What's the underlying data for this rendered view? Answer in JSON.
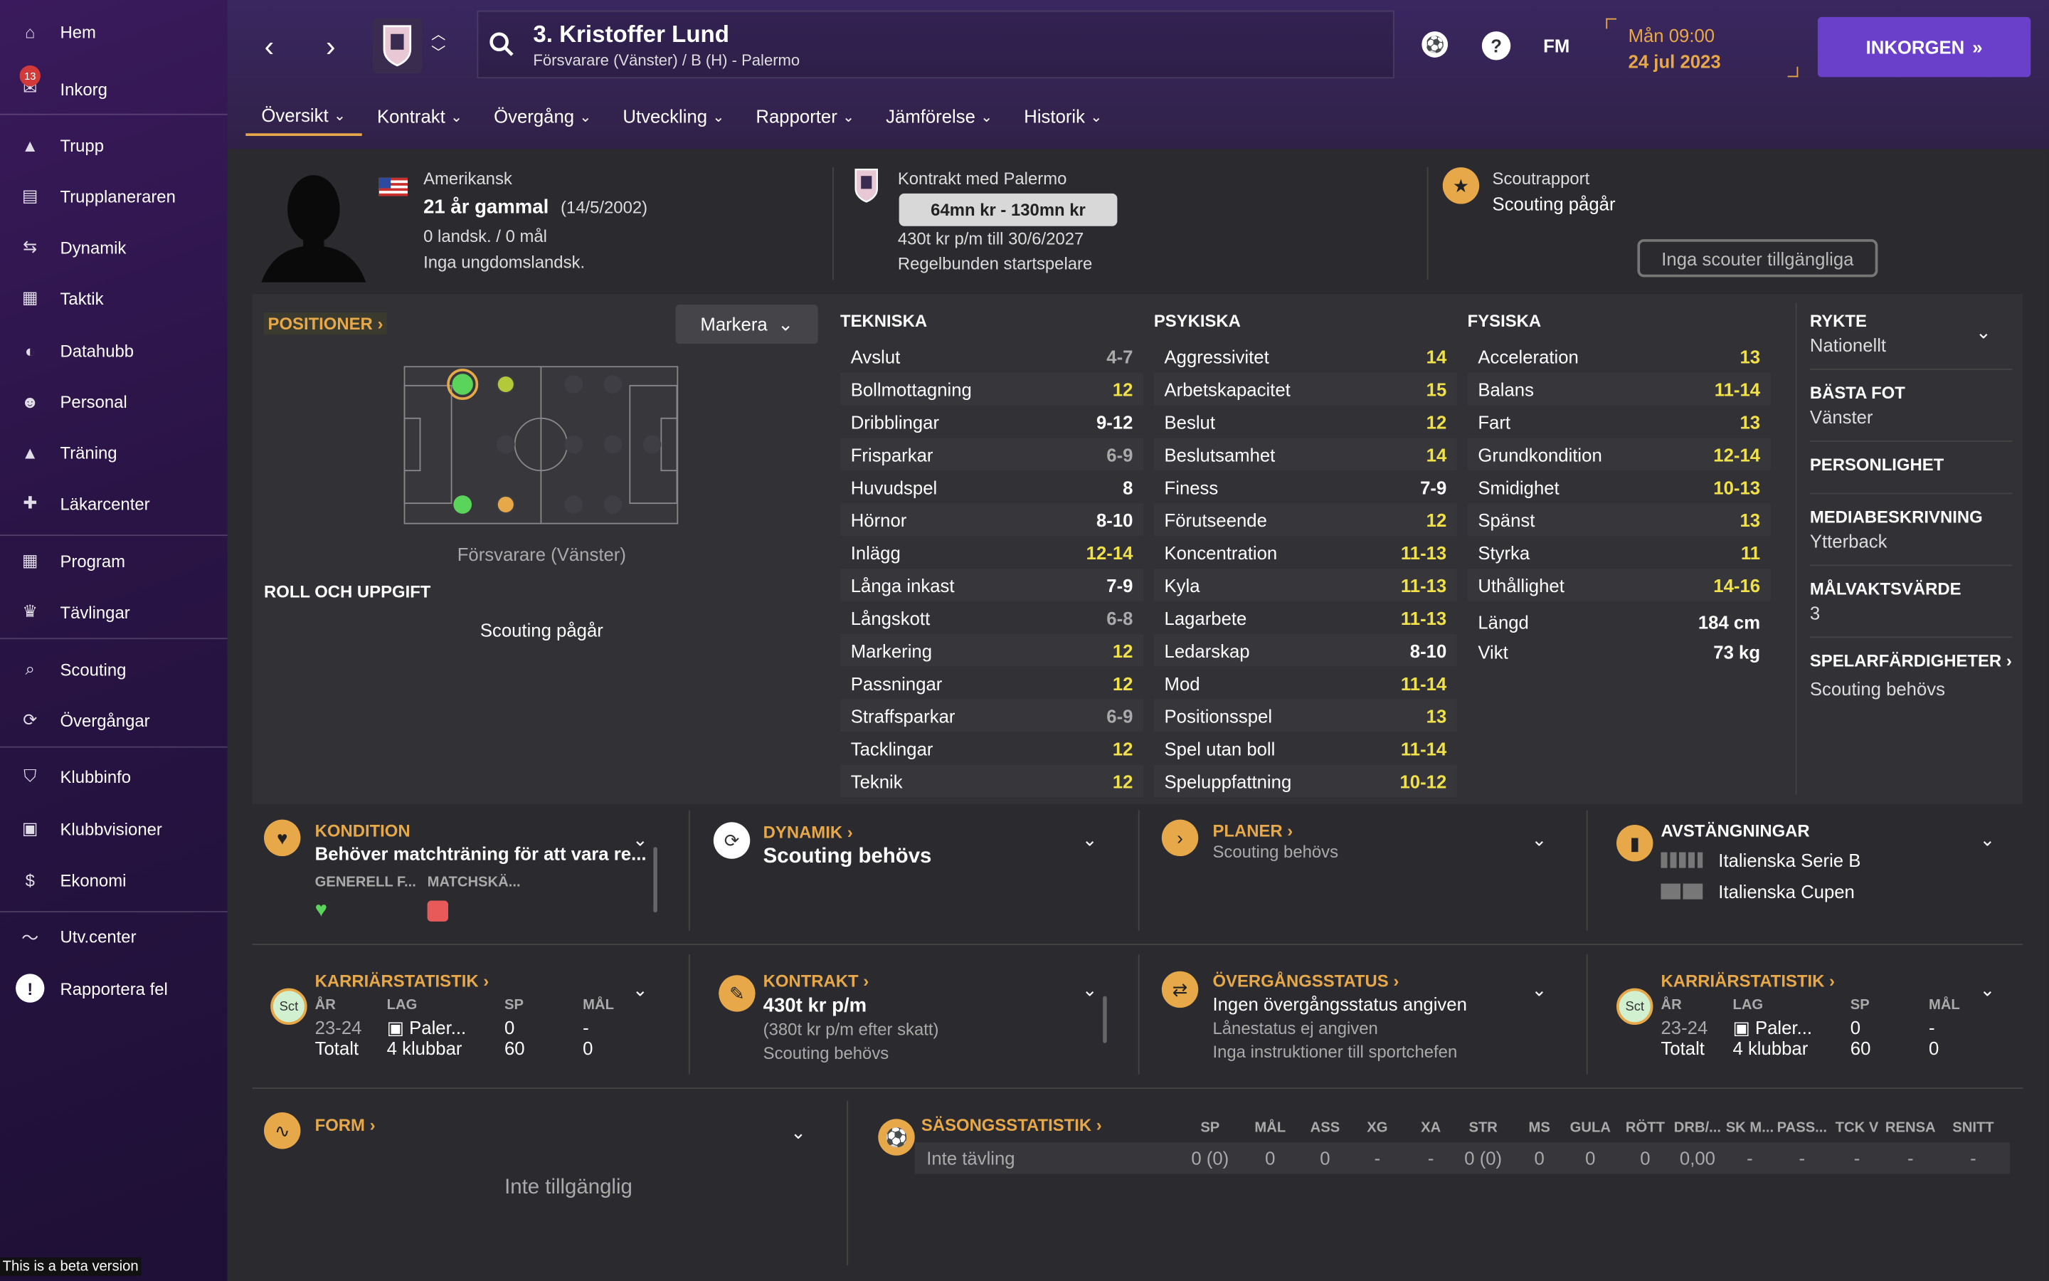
{
  "sidebar": {
    "items": [
      {
        "label": "Hem",
        "icon": "home-icon"
      },
      {
        "label": "Inkorg",
        "icon": "inbox-icon",
        "badge": "13"
      },
      {
        "label": "Trupp",
        "icon": "shirt-icon"
      },
      {
        "label": "Trupplaneraren",
        "icon": "clipboard-icon"
      },
      {
        "label": "Dynamik",
        "icon": "people-flow-icon"
      },
      {
        "label": "Taktik",
        "icon": "tactics-board-icon"
      },
      {
        "label": "Datahubb",
        "icon": "data-hub-icon"
      },
      {
        "label": "Personal",
        "icon": "staff-icon"
      },
      {
        "label": "Träning",
        "icon": "training-cone-icon"
      },
      {
        "label": "Läkarcenter",
        "icon": "medical-kit-icon"
      },
      {
        "label": "Program",
        "icon": "calendar-icon"
      },
      {
        "label": "Tävlingar",
        "icon": "trophy-icon"
      },
      {
        "label": "Scouting",
        "icon": "search-icon"
      },
      {
        "label": "Övergångar",
        "icon": "transfer-arrows-icon"
      },
      {
        "label": "Klubbinfo",
        "icon": "shield-icon"
      },
      {
        "label": "Klubbvisioner",
        "icon": "briefcase-icon"
      },
      {
        "label": "Ekonomi",
        "icon": "money-icon"
      },
      {
        "label": "Utv.center",
        "icon": "growth-chart-icon"
      },
      {
        "label": "Rapportera fel",
        "icon": "alert-icon"
      }
    ],
    "beta_text": "This is a beta version"
  },
  "header": {
    "title": "3. Kristoffer Lund",
    "subtitle": "Försvarare (Vänster) / B (H) - Palermo",
    "time": "Mån 09:00",
    "date": "24 jul 2023",
    "inbox_button": "INKORGEN",
    "fm_label": "FM",
    "tabs": [
      "Översikt",
      "Kontrakt",
      "Övergång",
      "Utveckling",
      "Rapporter",
      "Jämförelse",
      "Historik"
    ]
  },
  "profile": {
    "nationality": "Amerikansk",
    "age": "21 år gammal",
    "dob": "(14/5/2002)",
    "caps": "0 landsk. / 0 mål",
    "youth": "Inga ungdomslandsk.",
    "contract_title": "Kontrakt med Palermo",
    "value": "64mn kr - 130mn kr",
    "wage": "430t kr p/m till 30/6/2027",
    "role_status": "Regelbunden startspelare",
    "scout_title": "Scoutrapport",
    "scout_status": "Scouting pågår",
    "no_scouts": "Inga scouter tillgängliga"
  },
  "positions": {
    "header": "POSITIONER",
    "mark_button": "Markera",
    "position_label": "Försvarare (Vänster)",
    "role_header": "ROLL OCH UPPGIFT",
    "role_status": "Scouting pågår"
  },
  "attributes": {
    "technical": {
      "header": "TEKNISKA",
      "rows": [
        [
          "Avslut",
          "4-7"
        ],
        [
          "Bollmottagning",
          "12"
        ],
        [
          "Dribblingar",
          "9-12"
        ],
        [
          "Frisparkar",
          "6-9"
        ],
        [
          "Huvudspel",
          "8"
        ],
        [
          "Hörnor",
          "8-10"
        ],
        [
          "Inlägg",
          "12-14"
        ],
        [
          "Långa inkast",
          "7-9"
        ],
        [
          "Långskott",
          "6-8"
        ],
        [
          "Markering",
          "12"
        ],
        [
          "Passningar",
          "12"
        ],
        [
          "Straffsparkar",
          "6-9"
        ],
        [
          "Tacklingar",
          "12"
        ],
        [
          "Teknik",
          "12"
        ]
      ]
    },
    "mental": {
      "header": "PSYKISKA",
      "rows": [
        [
          "Aggressivitet",
          "14"
        ],
        [
          "Arbetskapacitet",
          "15"
        ],
        [
          "Beslut",
          "12"
        ],
        [
          "Beslutsamhet",
          "14"
        ],
        [
          "Finess",
          "7-9"
        ],
        [
          "Förutseende",
          "12"
        ],
        [
          "Koncentration",
          "11-13"
        ],
        [
          "Kyla",
          "11-13"
        ],
        [
          "Lagarbete",
          "11-13"
        ],
        [
          "Ledarskap",
          "8-10"
        ],
        [
          "Mod",
          "11-14"
        ],
        [
          "Positionsspel",
          "13"
        ],
        [
          "Spel utan boll",
          "11-14"
        ],
        [
          "Speluppfattning",
          "10-12"
        ]
      ]
    },
    "physical": {
      "header": "FYSISKA",
      "rows": [
        [
          "Acceleration",
          "13"
        ],
        [
          "Balans",
          "11-14"
        ],
        [
          "Fart",
          "13"
        ],
        [
          "Grundkondition",
          "12-14"
        ],
        [
          "Smidighet",
          "10-13"
        ],
        [
          "Spänst",
          "13"
        ],
        [
          "Styrka",
          "11"
        ],
        [
          "Uthållighet",
          "14-16"
        ]
      ],
      "height_label": "Längd",
      "height": "184 cm",
      "weight_label": "Vikt",
      "weight": "73 kg"
    }
  },
  "right_info": {
    "reputation_h": "RYKTE",
    "reputation": "Nationellt",
    "foot_h": "BÄSTA FOT",
    "foot": "Vänster",
    "personality_h": "PERSONLIGHET",
    "media_h": "MEDIABESKRIVNING",
    "media": "Ytterback",
    "gk_h": "MÅLVAKTSVÄRDE",
    "gk": "3",
    "traits_h": "SPELARFÄRDIGHETER",
    "traits": "Scouting behövs"
  },
  "cards": {
    "condition": {
      "title": "KONDITION",
      "text": "Behöver matchträning för att vara re...",
      "sub1": "GENERELL F...",
      "sub2": "MATCHSKÄ..."
    },
    "dynamics": {
      "title": "DYNAMIK",
      "text": "Scouting behövs"
    },
    "plans": {
      "title": "PLANER",
      "text": "Scouting behövs"
    },
    "bans": {
      "title": "AVSTÄNGNINGAR",
      "row1": "Italienska Serie B",
      "row2": "Italienska Cupen"
    },
    "career1": {
      "title": "KARRIÄRSTATISTIK",
      "badge": "Sct",
      "cols": [
        "ÅR",
        "LAG",
        "SP",
        "MÅL"
      ],
      "row1": [
        "23-24",
        "Paler...",
        "0",
        "-"
      ],
      "row2": [
        "Totalt",
        "4 klubbar",
        "60",
        "0"
      ]
    },
    "contract": {
      "title": "KONTRAKT",
      "text": "430t kr p/m",
      "sub1": "(380t kr p/m efter skatt)",
      "sub2": "Scouting behövs"
    },
    "transfer": {
      "title": "ÖVERGÅNGSSTATUS",
      "text": "Ingen övergångsstatus angiven",
      "sub1": "Lånestatus ej angiven",
      "sub2": "Inga instruktioner till sportchefen"
    },
    "career2": {
      "title": "KARRIÄRSTATISTIK",
      "badge": "Sct",
      "cols": [
        "ÅR",
        "LAG",
        "SP",
        "MÅL"
      ],
      "row1": [
        "23-24",
        "Paler...",
        "0",
        "-"
      ],
      "row2": [
        "Totalt",
        "4 klubbar",
        "60",
        "0"
      ]
    },
    "form": {
      "title": "FORM",
      "text": "Inte tillgänglig"
    },
    "season": {
      "title": "SÄSONGSSTATISTIK",
      "cols": [
        "SP",
        "MÅL",
        "ASS",
        "XG",
        "XA",
        "STR",
        "MS",
        "GULA",
        "RÖTT",
        "DRB/...",
        "SK M...",
        "PASS...",
        "TCK V",
        "RENSA",
        "SNITT"
      ],
      "row_label": "Inte tävling",
      "values": [
        "0 (0)",
        "0",
        "0",
        "-",
        "-",
        "0 (0)",
        "0",
        "0",
        "0",
        "0,00",
        "-",
        "-",
        "-",
        "-",
        "-"
      ]
    }
  },
  "colors": {
    "accent": "#e7a84a",
    "rating_yellow": "#f0e04a",
    "purple": "#6a3fc9"
  }
}
